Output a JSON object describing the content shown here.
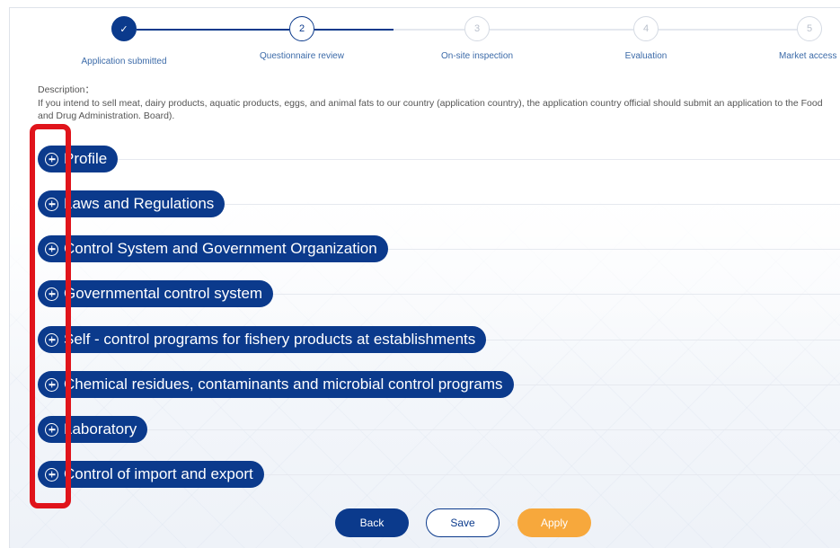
{
  "stepper": {
    "steps": [
      {
        "number": "✓",
        "label": "Application submitted",
        "state": "done"
      },
      {
        "number": "2",
        "label": "Questionnaire review",
        "state": "active"
      },
      {
        "number": "3",
        "label": "On-site inspection",
        "state": "pending"
      },
      {
        "number": "4",
        "label": "Evaluation",
        "state": "pending"
      },
      {
        "number": "5",
        "label": "Market access",
        "state": "pending"
      }
    ]
  },
  "description": {
    "title": "Description：",
    "text": "If you intend to sell meat, dairy products, aquatic products, eggs, and animal fats to our country (application country), the application country official should submit an application to the Food and Drug Administration. Board)."
  },
  "sections": [
    {
      "label": "Profile"
    },
    {
      "label": "Laws and Regulations"
    },
    {
      "label": "Control System and Government Organization"
    },
    {
      "label": "Governmental control system"
    },
    {
      "label": "Self - control programs for fishery products at establishments"
    },
    {
      "label": "Chemical residues, contaminants and microbial control programs"
    },
    {
      "label": "Laboratory"
    },
    {
      "label": "Control of import and export"
    }
  ],
  "actions": {
    "back_label": "Back",
    "save_label": "Save",
    "apply_label": "Apply"
  },
  "colors": {
    "primary": "#0b3a8c",
    "accent": "#f7a83c",
    "highlight": "#e0141b"
  }
}
